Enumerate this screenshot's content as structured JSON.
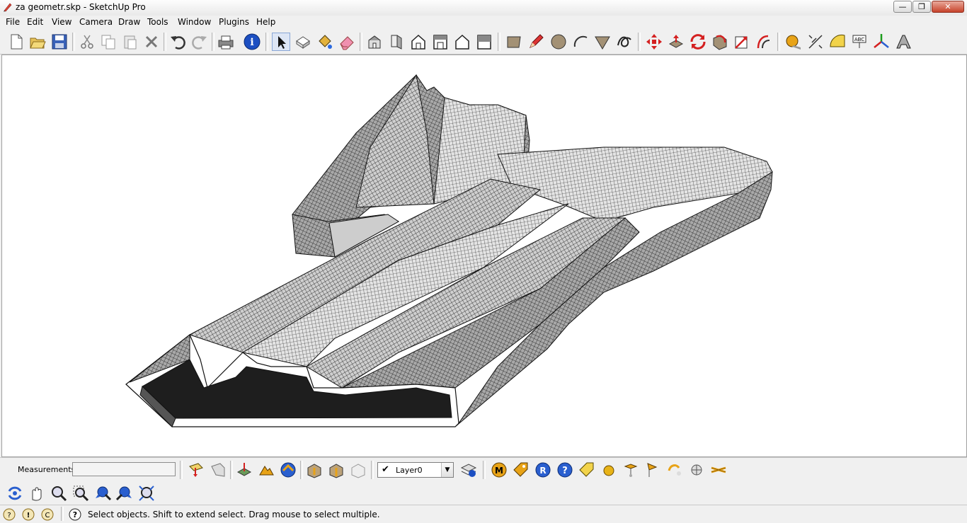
{
  "window": {
    "title": "za geometr.skp - SketchUp Pro",
    "minimize": "—",
    "maximize": "❐",
    "close": "✕"
  },
  "menu": [
    "File",
    "Edit",
    "View",
    "Camera",
    "Draw",
    "Tools",
    "Window",
    "Plugins",
    "Help"
  ],
  "toolbar": {
    "icons": [
      "new-file-icon",
      "open-file-icon",
      "save-icon",
      "cut-icon",
      "copy-icon",
      "paste-icon",
      "erase-x-icon",
      "undo-icon",
      "redo-icon",
      "print-icon",
      "model-info-icon",
      "select-arrow-icon",
      "make-component-icon",
      "paint-bucket-icon",
      "eraser-icon",
      "iso-view-icon",
      "front-view-icon",
      "top-view-icon",
      "right-view-icon",
      "back-view-icon",
      "left-view-icon",
      "rectangle-icon",
      "pencil-icon",
      "circle-icon",
      "arc-icon",
      "polygon-icon",
      "freehand-icon",
      "move-icon",
      "push-pull-icon",
      "rotate-icon",
      "follow-me-icon",
      "scale-icon",
      "offset-icon",
      "tape-measure-icon",
      "dimension-icon",
      "protractor-icon",
      "text-icon",
      "axes-icon",
      "3d-text-icon"
    ]
  },
  "measurements": {
    "label": "Measurements",
    "value": ""
  },
  "layer": {
    "name": "Layer0",
    "checked": "✔"
  },
  "status": {
    "text": "Select objects. Shift to extend select. Drag mouse to select multiple."
  },
  "colors": {
    "viewport_bg": "#ffffff",
    "chrome_bg": "#f0f0f0",
    "mesh_fill": "#bdbdbd",
    "mesh_dark": "#222222",
    "accent_red": "#d42020",
    "accent_blue": "#2a5fcf",
    "accent_orange": "#e8a317"
  }
}
